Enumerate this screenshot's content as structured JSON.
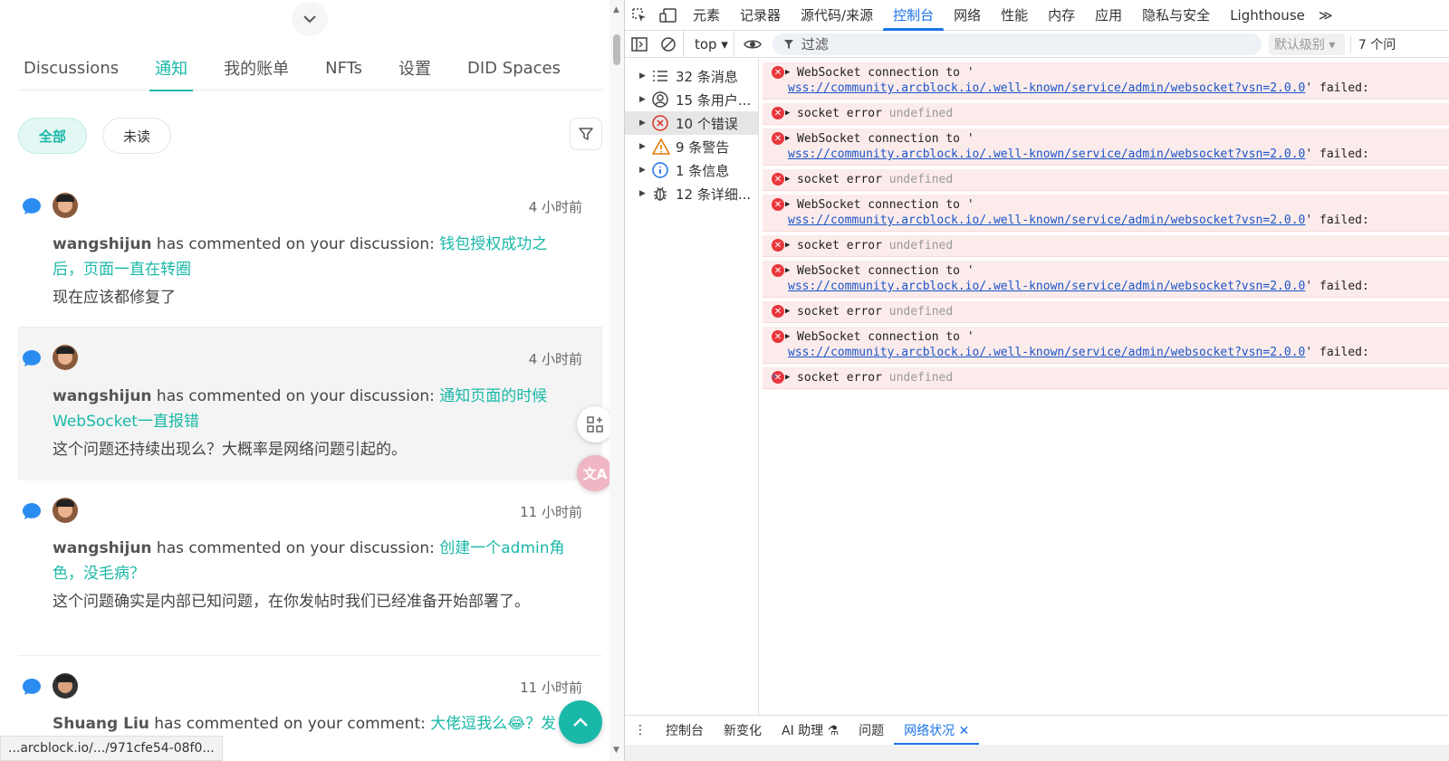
{
  "tabs": [
    "Discussions",
    "通知",
    "我的账单",
    "NFTs",
    "设置",
    "DID Spaces"
  ],
  "filters": {
    "all": "全部",
    "unread": "未读"
  },
  "notifications": [
    {
      "time": "4 小时前",
      "user": "wangshijun",
      "action": " has commented on your discussion: ",
      "link": "钱包授权成功之后，页面一直在转圈",
      "comment": "现在应该都修复了"
    },
    {
      "time": "4 小时前",
      "user": "wangshijun",
      "action": " has commented on your discussion: ",
      "link": "通知页面的时候WebSocket一直报错",
      "comment": "这个问题还持续出现么？大概率是网络问题引起的。"
    },
    {
      "time": "11 小时前",
      "user": "wangshijun",
      "action": " has commented on your discussion: ",
      "link": "创建一个admin角色，没毛病？",
      "comment": "这个问题确实是内部已知问题，在你发帖时我们已经准备开始部署了。"
    },
    {
      "time": "11 小时前",
      "user": "Shuang Liu",
      "action": " has commented on your comment: ",
      "link": "大佬逗我么😂？发"
    }
  ],
  "status_url": "...arcblock.io/.../971cfe54-08f0...",
  "translate_label": "文A",
  "devtools": {
    "tabs": [
      "元素",
      "记录器",
      "源代码/来源",
      "控制台",
      "网络",
      "性能",
      "内存",
      "应用",
      "隐私与安全",
      "Lighthouse"
    ],
    "more": "≫",
    "context": "top ▾",
    "filter_placeholder": "过滤",
    "level": "默认级别 ▾",
    "issues": "7 个问",
    "sidebar": [
      {
        "label": "32 条消息",
        "icon": "list-icon"
      },
      {
        "label": "15 条用户...",
        "icon": "user-icon"
      },
      {
        "label": "10 个错误",
        "icon": "error-icon"
      },
      {
        "label": "9 条警告",
        "icon": "warning-icon"
      },
      {
        "label": "1 条信息",
        "icon": "info-icon"
      },
      {
        "label": "12 条详细...",
        "icon": "bug-icon"
      }
    ],
    "ws_prefix": "WebSocket connection to '",
    "ws_url": "wss://community.arcblock.io/.well-known/service/admin/websocket?vsn=2.0.0",
    "ws_suffix": "' failed:",
    "socket_error": "socket error ",
    "undefined": "undefined",
    "prompt": "›",
    "drawer": [
      "控制台",
      "新变化",
      "AI 助理 ⚗",
      "问题",
      "网络状况 ✕"
    ]
  },
  "colors": {
    "accent": "#1ab8a8",
    "devtools_blue": "#1a73e8",
    "error_bg": "#fcebeb"
  }
}
